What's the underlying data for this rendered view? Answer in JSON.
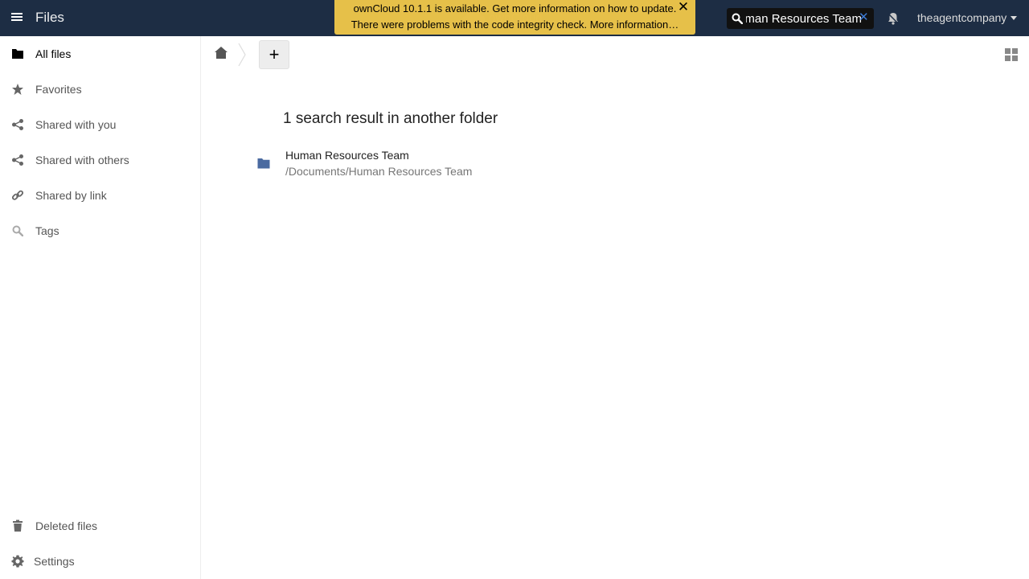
{
  "header": {
    "app_title": "Files",
    "logo_text": "ownCloud",
    "update_banner": {
      "line1": "ownCloud 10.1.1 is available. Get more information on how to update.",
      "line2": "There were problems with the code integrity check. More information…",
      "close_glyph": "✕"
    },
    "search": {
      "value": "Human Resources Team",
      "clear_glyph": "✕"
    },
    "user": "theagentcompany"
  },
  "sidebar": {
    "items": [
      {
        "label": "All files",
        "icon": "folder-icon",
        "active": true
      },
      {
        "label": "Favorites",
        "icon": "star-icon"
      },
      {
        "label": "Shared with you",
        "icon": "share-icon"
      },
      {
        "label": "Shared with others",
        "icon": "share-icon"
      },
      {
        "label": "Shared by link",
        "icon": "link-icon"
      },
      {
        "label": "Tags",
        "icon": "tag-search-icon"
      }
    ],
    "bottom": [
      {
        "label": "Deleted files",
        "icon": "trash-icon"
      },
      {
        "label": "Settings",
        "icon": "gear-icon"
      }
    ]
  },
  "controls": {
    "new_label": "+"
  },
  "main": {
    "search_heading": "1 search result in another folder",
    "results": [
      {
        "name": "Human Resources Team",
        "path": "/Documents/Human Resources Team",
        "icon": "folder-icon"
      }
    ]
  },
  "colors": {
    "header_bg": "#1d2d44",
    "banner_bg": "#ebc34a",
    "folder_icon": "#4a6aa0",
    "search_clear": "#3d7bd6"
  }
}
